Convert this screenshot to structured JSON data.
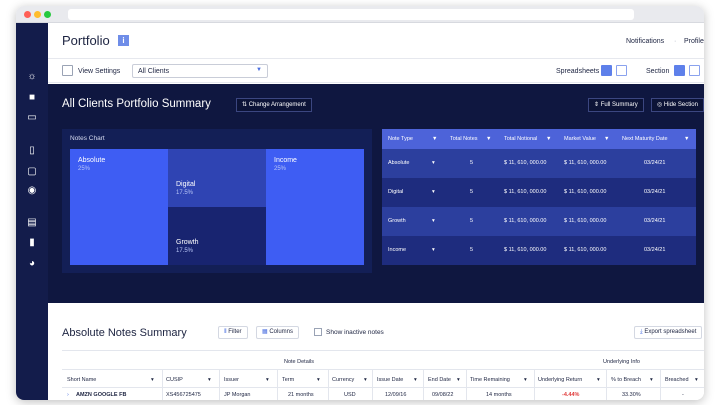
{
  "header": {
    "title": "Portfolio",
    "info_icon": "info-icon",
    "notifications": "Notifications",
    "profile": "Profile"
  },
  "toolbar": {
    "view_settings": "View Settings",
    "client_select": "All Clients",
    "spreadsheets": "Spreadsheets",
    "section": "Section"
  },
  "summary": {
    "title": "All Clients Portfolio Summary",
    "change_arrangement": "Change Arrangement",
    "full_summary": "Full Summary",
    "hide_section": "Hide Section",
    "chart_label": "Notes Chart",
    "treemap": [
      {
        "name": "Absolute",
        "pct": "25%",
        "color": "#3e5df3"
      },
      {
        "name": "Digital",
        "pct": "17.5%",
        "color": "#2f44b3"
      },
      {
        "name": "Growth",
        "pct": "17.5%",
        "color": "#182470"
      },
      {
        "name": "Income",
        "pct": "25%",
        "color": "#3e5df3"
      }
    ],
    "table": {
      "headers": [
        "Note Type",
        "Total Notes",
        "Total Notional",
        "Market Value",
        "Next Maturity Date"
      ],
      "rows": [
        {
          "type": "Absolute",
          "notes": "5",
          "notional": "$ 11, 610, 000.00",
          "market": "$ 11, 610, 000.00",
          "date": "03/24/21"
        },
        {
          "type": "Digital",
          "notes": "5",
          "notional": "$ 11, 610, 000.00",
          "market": "$ 11, 610, 000.00",
          "date": "03/24/21"
        },
        {
          "type": "Growth",
          "notes": "5",
          "notional": "$ 11, 610, 000.00",
          "market": "$ 11, 610, 000.00",
          "date": "03/24/21"
        },
        {
          "type": "Income",
          "notes": "5",
          "notional": "$ 11, 610, 000.00",
          "market": "$ 11, 610, 000.00",
          "date": "03/24/21"
        }
      ]
    }
  },
  "notes": {
    "title": "Absolute Notes Summary",
    "filter": "Filter",
    "columns": "Columns",
    "show_inactive": "Show inactive notes",
    "export": "Export spreadsheet",
    "group_note_details": "Note Details",
    "group_underlying_info": "Underlying Info",
    "columns_list": [
      "Short Name",
      "CUSIP",
      "Issuer",
      "Term",
      "Currency",
      "Issue Date",
      "End Date",
      "Time Remaining",
      "Underlying Return",
      "% to Breach",
      "Breached"
    ],
    "row": {
      "short_name": "AMZN GOOGLE FB",
      "cusip": "XS456725475",
      "issuer": "JP Morgan",
      "term": "21 months",
      "currency": "USD",
      "issue_date": "12/09/16",
      "end_date": "09/08/22",
      "time_remaining": "14 months",
      "underlying_return": "-4.44%",
      "to_breach": "33.30%",
      "breached": "-"
    }
  },
  "colors": {
    "sidebar": "#131c4b",
    "summary_bg": "#0f1740",
    "table_header": "#4d63d9",
    "negative": "#e03a3a"
  }
}
